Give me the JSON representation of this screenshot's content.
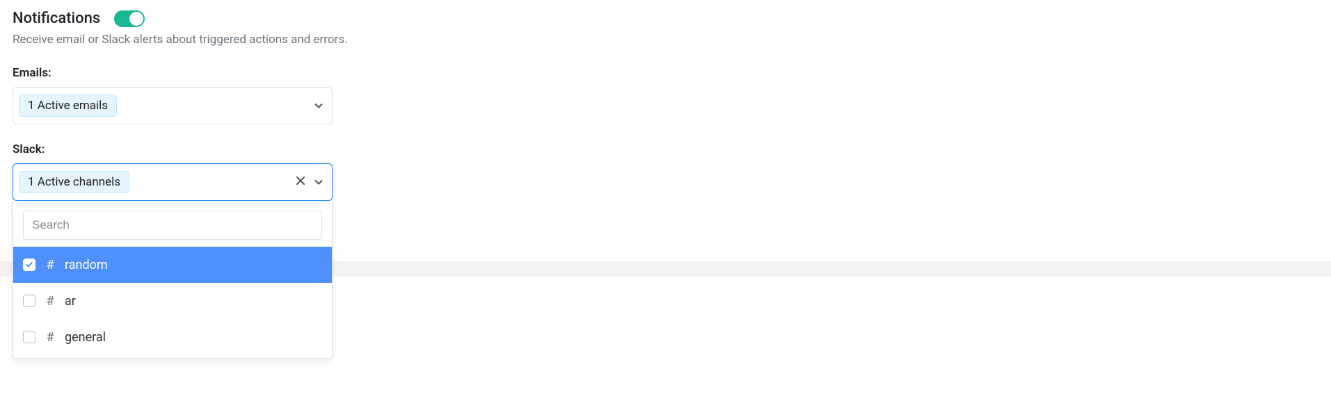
{
  "section": {
    "title": "Notifications",
    "description": "Receive email or Slack alerts about triggered actions and errors.",
    "toggle_on": true
  },
  "emails": {
    "label": "Emails:",
    "tag": "1 Active emails"
  },
  "slack": {
    "label": "Slack:",
    "tag": "1 Active channels",
    "search_placeholder": "Search",
    "options": [
      {
        "hash": "#",
        "label": "random",
        "checked": true
      },
      {
        "hash": "#",
        "label": "ar",
        "checked": false
      },
      {
        "hash": "#",
        "label": "general",
        "checked": false
      }
    ]
  }
}
